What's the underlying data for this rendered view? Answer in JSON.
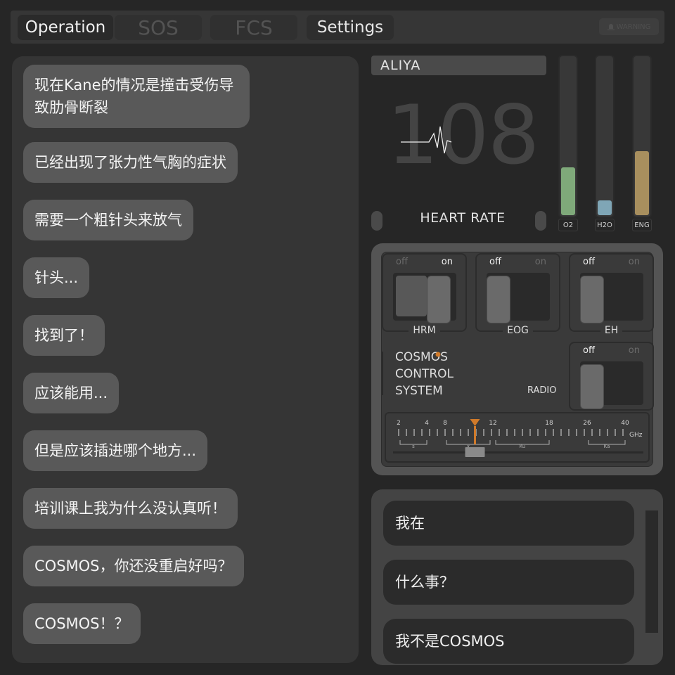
{
  "tabs": [
    {
      "label": "Operation"
    },
    {
      "label": "SOS"
    },
    {
      "label": "FCS"
    },
    {
      "label": "Settings"
    }
  ],
  "warning": {
    "label": "WARNING",
    "icon": "alarm-icon"
  },
  "chat_messages": [
    "现在Kane的情况是撞击受伤导",
    "致肋骨断裂",
    "已经出现了张力性气胸的症状",
    "需要一个粗针头来放气",
    "针头...",
    "找到了！",
    "应该能用...",
    "但是应该插进哪个地方...",
    "培训课上我为什么没认真听！",
    "COSMOS，你还没重启好吗？",
    "COSMOS！？"
  ],
  "patient": {
    "name": "ALIYA",
    "heart_rate": "108",
    "heart_rate_label": "HEART RATE"
  },
  "gauges": [
    {
      "label": "O2",
      "level": 0.3,
      "color": "#7fa97a"
    },
    {
      "label": "H2O",
      "level": 0.09,
      "color": "#7fa6b6"
    },
    {
      "label": "ENG",
      "level": 0.4,
      "color": "#a88f5e"
    }
  ],
  "switches": [
    {
      "name": "HRM",
      "off": "off",
      "on": "on",
      "state": "on"
    },
    {
      "name": "EOG",
      "off": "off",
      "on": "on",
      "state": "off"
    },
    {
      "name": "EH",
      "off": "off",
      "on": "on",
      "state": "off"
    },
    {
      "name": "RADIO",
      "off": "off",
      "on": "on",
      "state": "off"
    }
  ],
  "system": {
    "line1": "COSMOS",
    "line2": "CONTROL",
    "line3": "SYSTEM"
  },
  "tuner": {
    "ticks": [
      "2",
      "4",
      "8",
      "12",
      "18",
      "26",
      "40"
    ],
    "unit": "GHz",
    "bands": [
      "s",
      "x",
      "Ku",
      "Ka"
    ],
    "frequency": 10.5,
    "accent": "#d07a2a"
  },
  "replies": [
    "我在",
    "什么事？",
    "我不是COSMOS"
  ]
}
